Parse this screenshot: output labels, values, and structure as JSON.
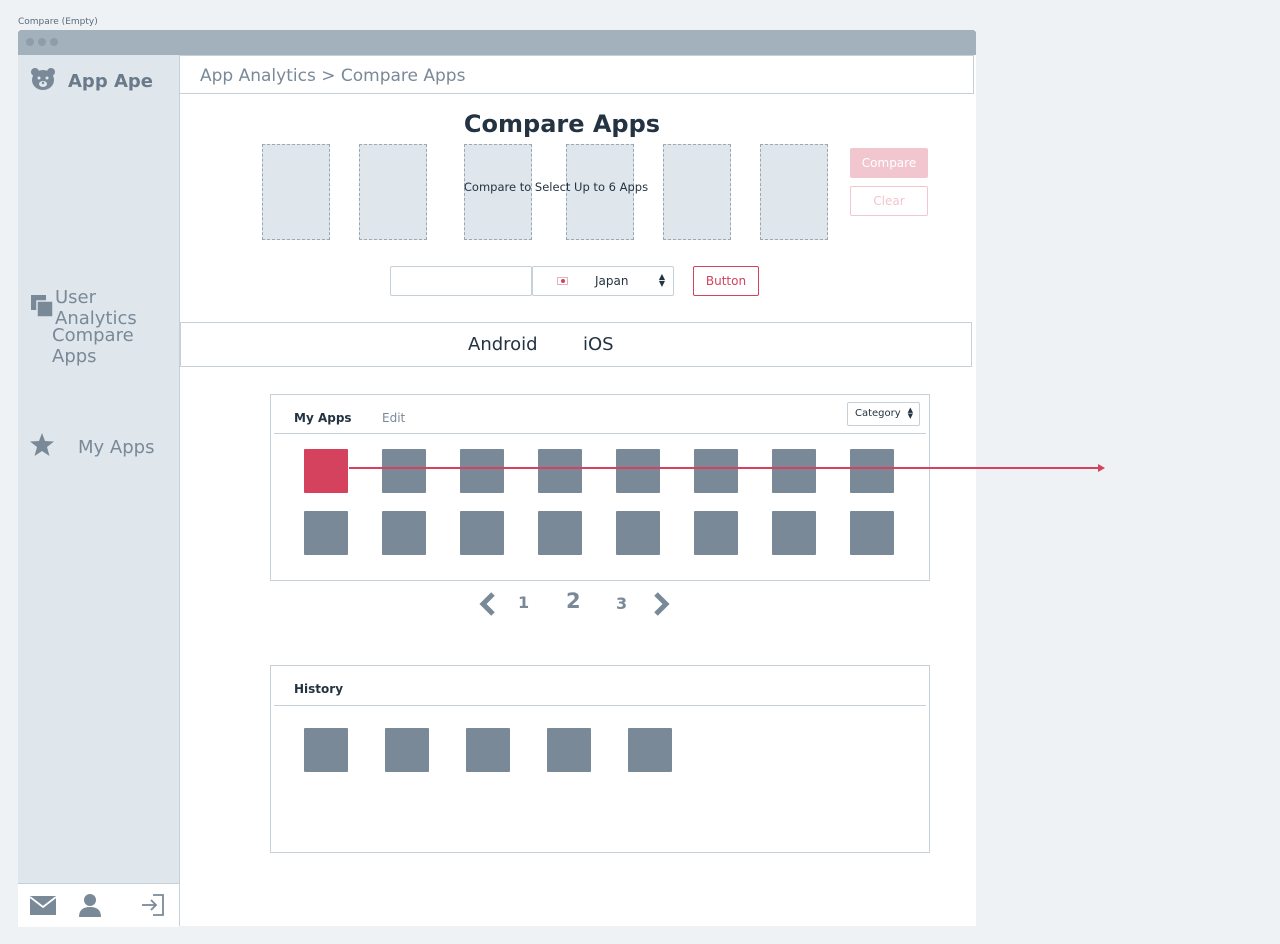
{
  "page_label": "Compare (Empty)",
  "brand": {
    "name": "App Ape",
    "logo_icon": "bear-icon"
  },
  "sidebar": {
    "user_analytics": "User Analytics",
    "compare_apps": "Compare Apps",
    "my_apps": "My Apps",
    "footer_icons": [
      "mail-icon",
      "user-icon",
      "logout-icon"
    ]
  },
  "header": {
    "breadcrumb": "App Analytics > Compare Apps"
  },
  "main": {
    "title": "Compare Apps",
    "slot_hint": "Compare to Select Up to 6 Apps",
    "slot_count": 6,
    "compare_button": "Compare",
    "clear_button": "Clear",
    "search": {
      "value": "",
      "placeholder": ""
    },
    "country": {
      "selected": "Japan"
    },
    "button_label": "Button",
    "platform_tabs": [
      "Android",
      "iOS"
    ]
  },
  "my_apps_panel": {
    "title": "My Apps",
    "edit_label": "Edit",
    "category_label": "Category",
    "rows": 2,
    "cols": 8,
    "selected_index": 0
  },
  "pagination": {
    "pages": [
      "1",
      "2",
      "3"
    ],
    "current": "2"
  },
  "history_panel": {
    "title": "History",
    "count": 5
  },
  "colors": {
    "accent": "#d4425d",
    "accent_light": "#f2c6cf",
    "tile": "#7a8998",
    "sidebar_bg": "#dfe6ec",
    "titlebar": "#a3b1bd"
  }
}
